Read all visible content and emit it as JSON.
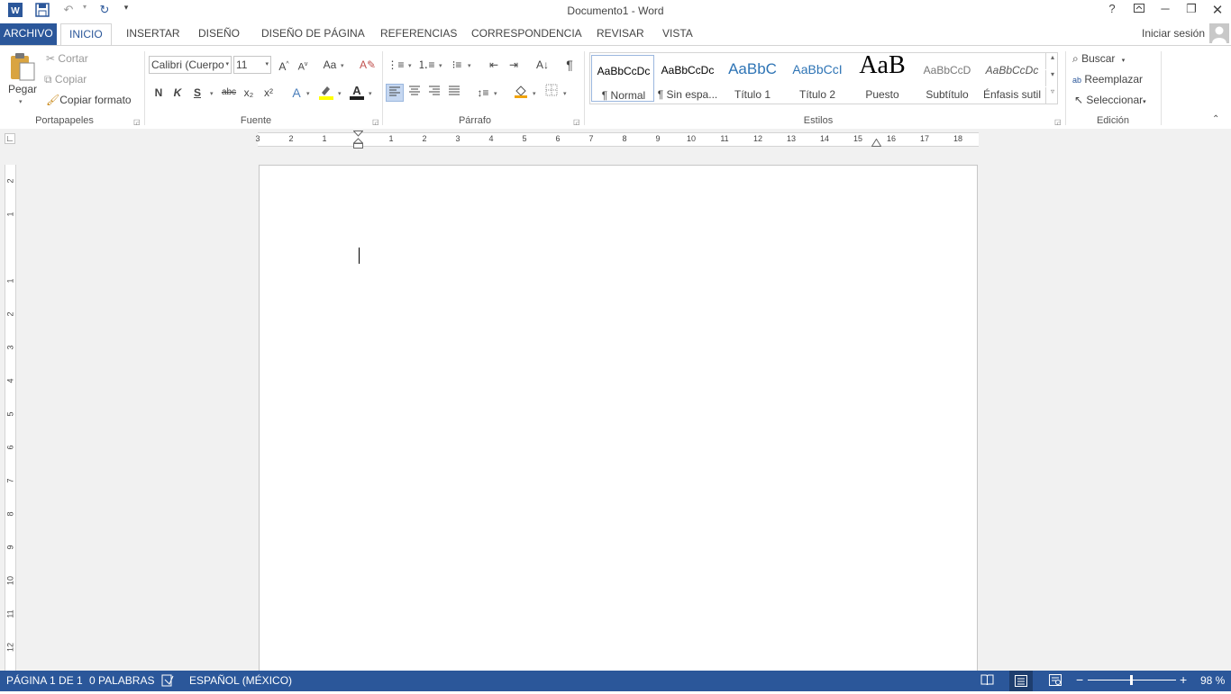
{
  "window": {
    "title": "Documento1 - Word",
    "help": "?",
    "sign_in": "Iniciar sesión"
  },
  "qat": {
    "word_icon": "word-logo-icon",
    "save_icon": "save-icon",
    "undo_icon": "undo-icon",
    "redo_icon": "redo-icon",
    "customize_icon": "customize-qat-icon"
  },
  "tabs": [
    {
      "label": "ARCHIVO"
    },
    {
      "label": "INICIO"
    },
    {
      "label": "INSERTAR"
    },
    {
      "label": "DISEÑO"
    },
    {
      "label": "DISEÑO DE PÁGINA"
    },
    {
      "label": "REFERENCIAS"
    },
    {
      "label": "CORRESPONDENCIA"
    },
    {
      "label": "REVISAR"
    },
    {
      "label": "VISTA"
    }
  ],
  "clipboard": {
    "paste": "Pegar",
    "cut": "Cortar",
    "copy": "Copiar",
    "format_painter": "Copiar formato",
    "group": "Portapapeles"
  },
  "font": {
    "name": "Calibri (Cuerpo",
    "size": "11",
    "bold": "N",
    "italic": "K",
    "underline": "S",
    "strike": "abc",
    "sub": "x₂",
    "sup": "x²",
    "change_case": "Aa",
    "group": "Fuente",
    "highlight_color": "#ffff00",
    "font_color": "#c00000"
  },
  "paragraph": {
    "group": "Párrafo",
    "pilcrow": "¶"
  },
  "styles": {
    "group": "Estilos",
    "items": [
      {
        "sample": "AaBbCcDc",
        "name": "¶ Normal"
      },
      {
        "sample": "AaBbCcDc",
        "name": "¶ Sin espa..."
      },
      {
        "sample": "AaBbC",
        "name": "Título 1"
      },
      {
        "sample": "AaBbCcI",
        "name": "Título 2"
      },
      {
        "sample": "AaB",
        "name": "Puesto"
      },
      {
        "sample": "AaBbCcD",
        "name": "Subtítulo"
      },
      {
        "sample": "AaBbCcDc",
        "name": "Énfasis sutil"
      }
    ]
  },
  "editing": {
    "find": "Buscar",
    "replace": "Reemplazar",
    "select": "Seleccionar",
    "group": "Edición"
  },
  "ruler": {
    "h_labels": [
      "3",
      "2",
      "1",
      "1",
      "2",
      "3",
      "4",
      "5",
      "6",
      "7",
      "8",
      "9",
      "10",
      "11",
      "12",
      "13",
      "14",
      "15",
      "16",
      "17",
      "18"
    ],
    "v_labels": [
      "2",
      "1",
      "1",
      "2",
      "3",
      "4",
      "5",
      "6",
      "7",
      "8",
      "9",
      "10",
      "11",
      "12"
    ]
  },
  "status": {
    "page": "PÁGINA 1 DE 1",
    "words": "0 PALABRAS",
    "language": "ESPAÑOL (MÉXICO)",
    "zoom": "98 %",
    "zoom_level": 0.98
  },
  "colors": {
    "accent": "#2b579a"
  }
}
